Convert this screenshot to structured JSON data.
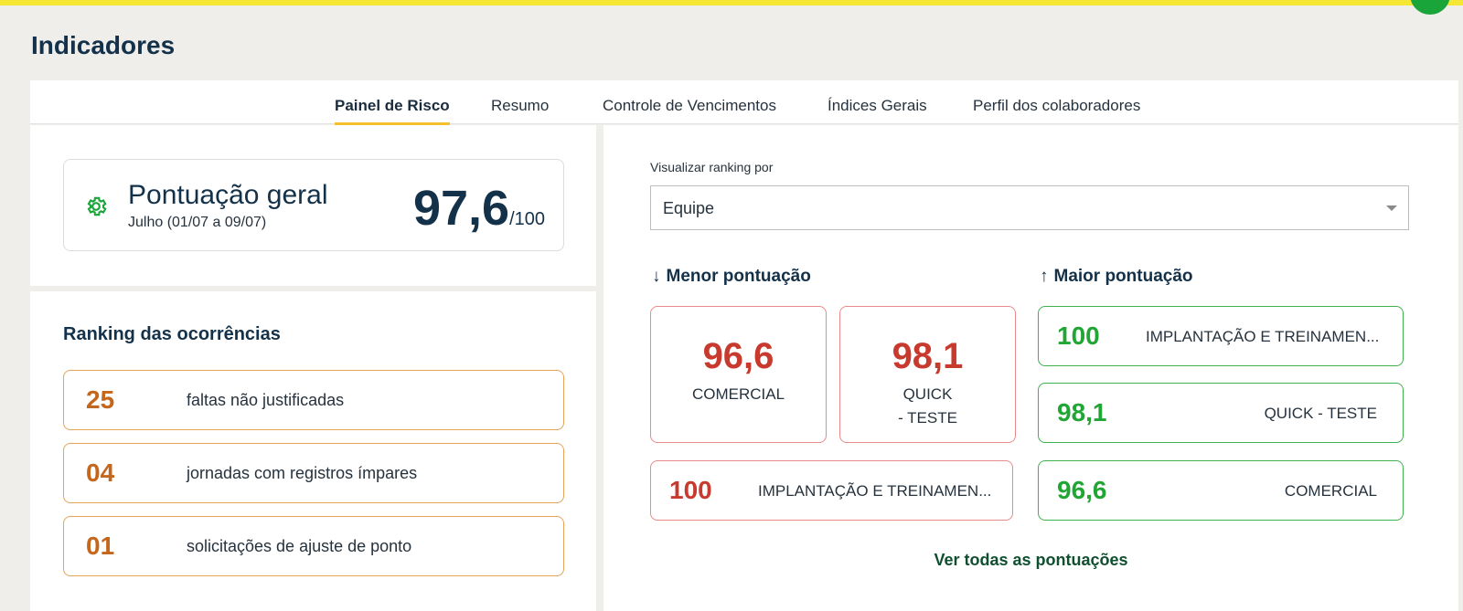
{
  "page": {
    "title": "Indicadores"
  },
  "tabs": [
    {
      "label": "Painel de Risco",
      "active": true
    },
    {
      "label": "Resumo"
    },
    {
      "label": "Controle de Vencimentos"
    },
    {
      "label": "Índices Gerais"
    },
    {
      "label": "Perfil dos colaboradores"
    }
  ],
  "score": {
    "label": "Pontuação geral",
    "period": "Julho (01/07 a 09/07)",
    "value": "97,6",
    "max": "/100",
    "icon": "gear-icon"
  },
  "ranking": {
    "title": "Ranking das ocorrências",
    "items": [
      {
        "count": "25",
        "text": "faltas não justificadas"
      },
      {
        "count": "04",
        "text": "jornadas com registros ímpares"
      },
      {
        "count": "01",
        "text": "solicitações de ajuste de ponto"
      }
    ]
  },
  "ranking_view": {
    "label": "Visualizar ranking por",
    "selected": "Equipe"
  },
  "lowest": {
    "title": "Menor pontuação",
    "arrow": "↓",
    "cards": [
      {
        "value": "96,6",
        "name": "COMERCIAL"
      },
      {
        "value": "98,1",
        "name_line1": "QUICK",
        "name_line2": "- TESTE"
      }
    ],
    "row": {
      "value": "100",
      "name": "IMPLANTAÇÃO E TREINAMEN..."
    }
  },
  "highest": {
    "title": "Maior pontuação",
    "arrow": "↑",
    "rows": [
      {
        "value": "100",
        "name": "IMPLANTAÇÃO E TREINAMEN..."
      },
      {
        "value": "98,1",
        "name": "QUICK - TESTE"
      },
      {
        "value": "96,6",
        "name": "COMERCIAL"
      }
    ]
  },
  "see_all": "Ver todas as pontuações",
  "colors": {
    "accent_yellow": "#f5e634",
    "tab_underline": "#f3bf2d",
    "low_red": "#c83a2e",
    "high_green": "#21a534",
    "occurrence_orange": "#c4661c"
  }
}
